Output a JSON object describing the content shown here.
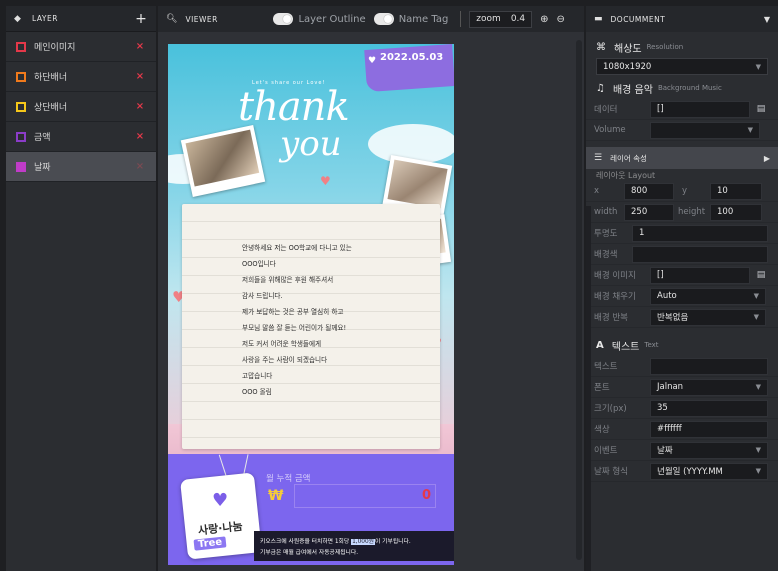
{
  "layer_panel": {
    "title": "LAYER",
    "add_label": "+",
    "items": [
      {
        "label": "메인이미지",
        "color": "#e4384a",
        "delete": "×"
      },
      {
        "label": "하단배너",
        "color": "#f07a1c",
        "delete": "×"
      },
      {
        "label": "상단배너",
        "color": "#f5c71a",
        "delete": "×"
      },
      {
        "label": "금액",
        "color": "#8b3cc8",
        "delete": "×"
      },
      {
        "label": "날짜",
        "color": "#c03cc8",
        "delete": "×",
        "selected": true
      }
    ]
  },
  "viewer": {
    "title": "VIEWER",
    "layer_outline_label": "Layer Outline",
    "name_tag_label": "Name Tag",
    "zoom_label": "zoom",
    "zoom_value": "0.4"
  },
  "canvas": {
    "date": "2022.05.03",
    "lets_share": "Let's share our Love!",
    "thank": "thank",
    "you": "you",
    "letter_lines": [
      "안녕하세요 저는 OO학교에 다니고 있는",
      "OOO입니다",
      "저희들을 위해많은 후원 해주셔서",
      "감사 드립니다.",
      "제가 보답하는 것은 공부 열심히 하고",
      "부모님 말씀 잘 듣는 어린이가 될께요!",
      "저도 커서 어려운 학생들에게",
      "사랑을 주는 사람이 되겠습니다",
      "고맙습니다",
      "OOO 올림"
    ],
    "total_label": "월 누적 금액",
    "won_symbol": "₩",
    "amount": "0",
    "tag_text": "사랑·나눔",
    "tag_tree": "Tree",
    "strip_line1_pre": "키오스크에 사원증을 터치하면 1회당 ",
    "strip_line1_hl": "1,000원",
    "strip_line1_post": "이 기부됩니다.",
    "strip_line2": "기부금은 매월 급여에서 자동공제됩니다."
  },
  "document_panel": {
    "title": "DOCUMMENT",
    "resolution_title": "해상도",
    "resolution_sub": "Resolution",
    "resolution_value": "1080x1920",
    "music_title": "배경 음악",
    "music_sub": "Background Music",
    "data_label": "데이터",
    "data_value": "[]",
    "volume_label": "Volume",
    "volume_value": ""
  },
  "layer_props": {
    "title": "레이어 속성",
    "hidden_title": "레이아웃 Layout",
    "x_label": "x",
    "x_value": "800",
    "y_label": "y",
    "y_value": "10",
    "width_label": "width",
    "width_value": "250",
    "height_label": "height",
    "height_value": "100",
    "opacity_label": "투명도",
    "opacity_value": "1",
    "bgcolor_label": "배경색",
    "bgcolor_value": "",
    "bgimage_label": "배경 이미지",
    "bgimage_value": "[]",
    "bgfill_label": "배경 채우기",
    "bgfill_value": "Auto",
    "bgrepeat_label": "배경 반복",
    "bgrepeat_value": "반복없음"
  },
  "text_props": {
    "title": "텍스트",
    "sub": "Text",
    "text_label": "텍스트",
    "text_value": "",
    "font_label": "폰트",
    "font_value": "Jalnan",
    "size_label": "크기(px)",
    "size_value": "35",
    "color_label": "색상",
    "color_value": "#ffffff",
    "event_label": "이벤트",
    "event_value": "날짜",
    "dateformat_label": "날짜 형식",
    "dateformat_value": "년월일 (YYYY.MM"
  }
}
